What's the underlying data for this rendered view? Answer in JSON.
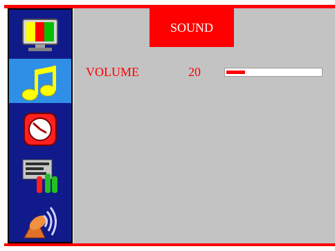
{
  "menu": {
    "items": [
      {
        "icon": "display-monitor-icon",
        "selected": false
      },
      {
        "icon": "music-notes-icon",
        "selected": true
      },
      {
        "icon": "clock-icon",
        "selected": false
      },
      {
        "icon": "language-settings-icon",
        "selected": false
      },
      {
        "icon": "satellite-dish-icon",
        "selected": false
      }
    ]
  },
  "panel": {
    "title": "SOUND",
    "volume": {
      "label": "VOLUME",
      "value": "20",
      "level_percent": 20
    }
  },
  "colors": {
    "accent": "#ff0000",
    "sidebar_bg": "#111a8a",
    "selected_bg": "#2f8fe6",
    "panel_bg": "#c3c3c3",
    "text": "#ff0000",
    "title_text": "#ffffff"
  }
}
